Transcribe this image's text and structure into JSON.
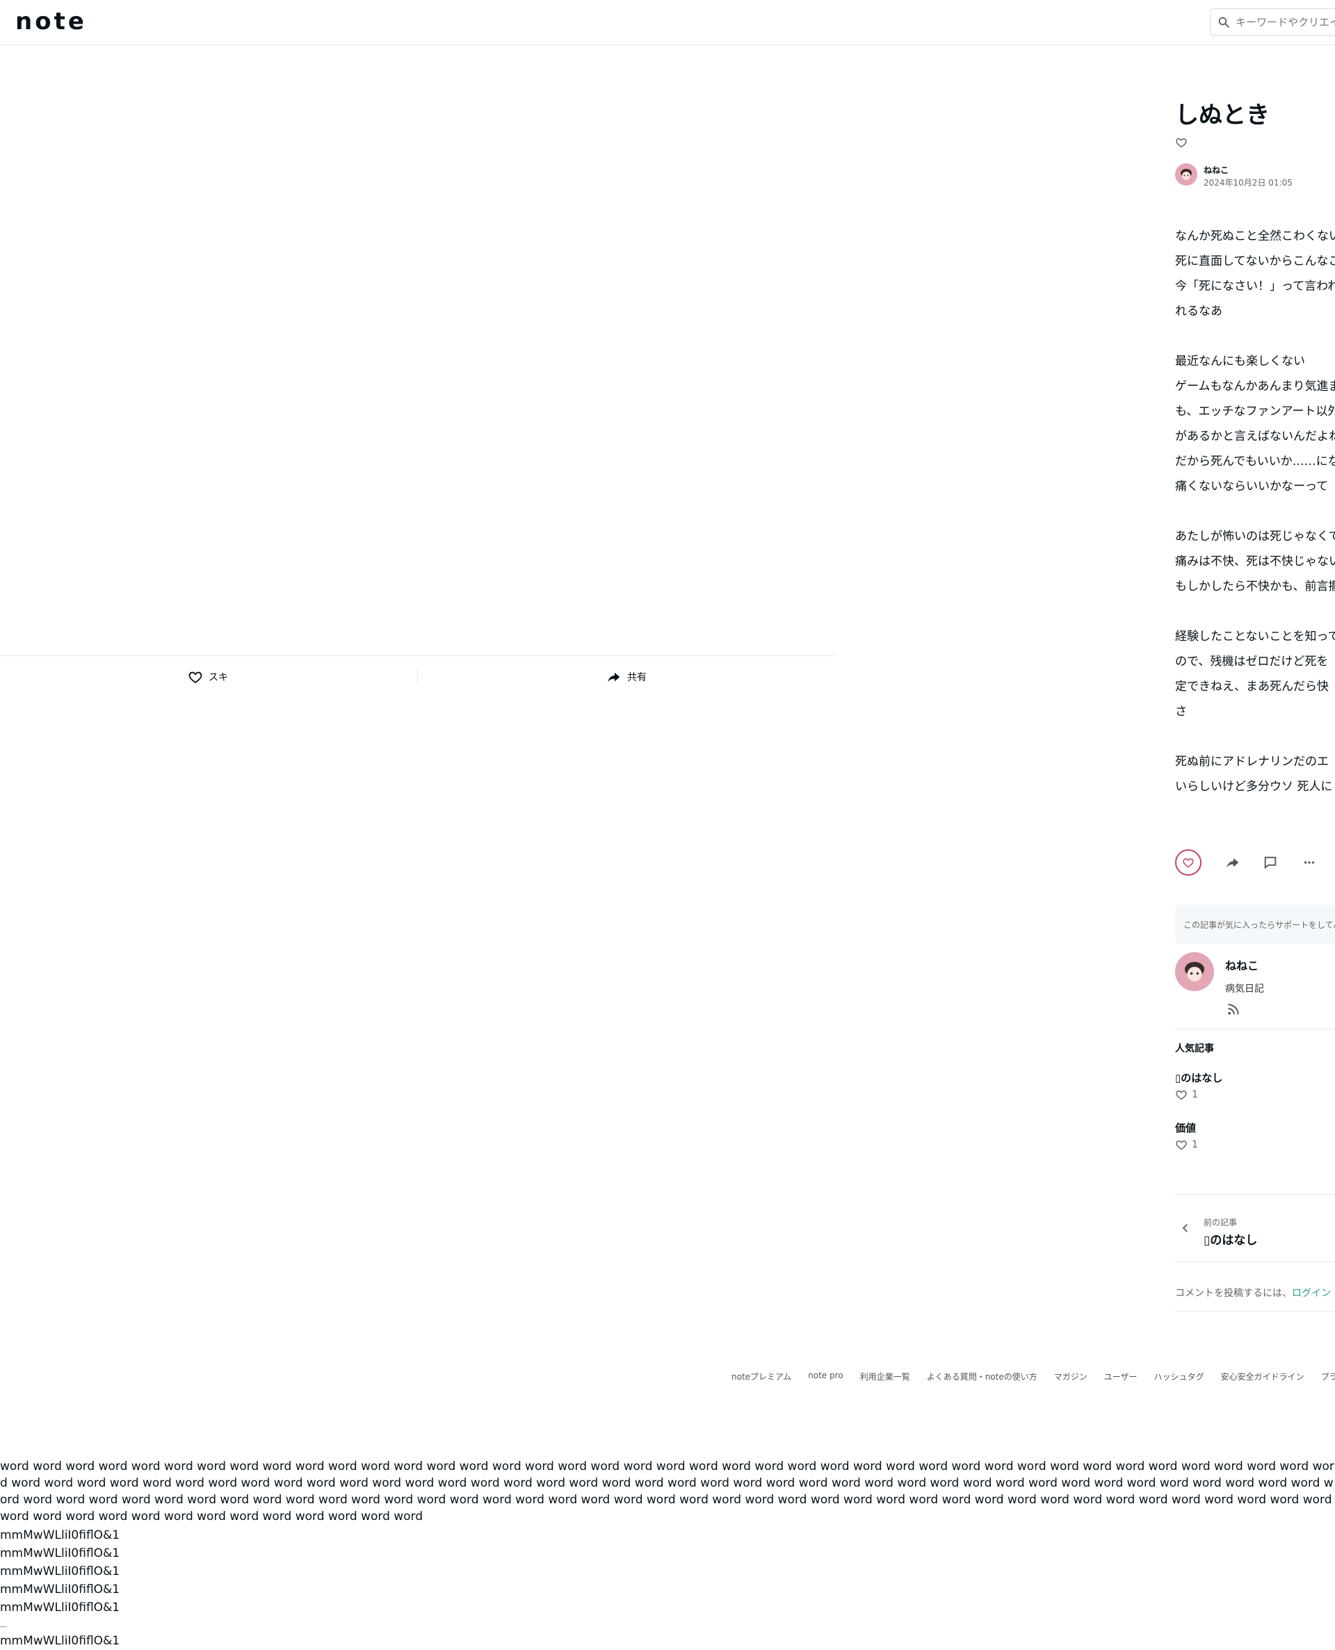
{
  "header": {
    "logo": "note",
    "search_placeholder": "キーワードやクリエイター"
  },
  "left_bar": {
    "like_label": "スキ",
    "share_label": "共有"
  },
  "article": {
    "title": "しぬとき",
    "author": "ねねこ",
    "date": "2024年10月2日 01:05",
    "paragraphs": [
      [
        "なんか死ぬこと全然こわくないん",
        "死に直面してないからこんなこと",
        "今「死になさい！」って言われたら",
        "れるなあ"
      ],
      [
        "最近なんにも楽しくない",
        "ゲームもなんかあんまり気進まない",
        "も、エッチなファンアート以外に",
        "があるかと言えばないんだよね",
        "だから死んでもいいか……にな",
        "痛くないならいいかなーって"
      ],
      [
        "あたしが怖いのは死じゃなくて",
        "痛みは不快、死は不快じゃない",
        "もしかしたら不快かも、前言撤回"
      ],
      [
        "経験したことないことを知って",
        "ので、残機はゼロだけど死を",
        "定できねえ、まあ死んだら快",
        "さ"
      ],
      [
        "死ぬ前にアドレナリンだのエ",
        "いらしいけど多分ウソ 死人に"
      ]
    ]
  },
  "support": {
    "text": "この記事が気に入ったらサポートをしてみませんか？"
  },
  "creator": {
    "name": "ねねこ",
    "description": "病気日記"
  },
  "popular": {
    "heading": "人気記事",
    "items": [
      {
        "title": "のはなし",
        "likes": "1"
      },
      {
        "title": "価値",
        "likes": "1"
      }
    ]
  },
  "prev": {
    "label": "前の記事",
    "title": "のはなし"
  },
  "comment": {
    "prefix": "コメントを投稿するには、",
    "link": "ログイン"
  },
  "footer": {
    "links": [
      "noteプレミアム",
      "note pro",
      "利用企業一覧",
      "よくある質問・noteの使い方",
      "マガジン",
      "ユーザー",
      "ハッシュタグ",
      "安心安全ガイドライン",
      "プライバシー"
    ]
  },
  "test_text": {
    "words": "word word word word word word word word word word word word word word word word word word word word word word word word word word word word word word word word word word word word word word word word word word word word word word word word word word word word word word word word word word word word word word word word word word word word word word word word word word word word word word word word word word word word word word word word word word word word word word word word word word word word word word word word word word word word word word word word word word word word word word word word word word word word word word word word word word word word word word word",
    "glyphs": [
      "mmMwWLliI0fiflO&1",
      "mmMwWLliI0fiflO&1",
      "mmMwWLliI0fiflO&1",
      "mmMwWLliI0fiflO&1",
      "mmMwWLliI0fiflO&1"
    ],
    "glyph_last": "mmMwWLliI0fiflO&1"
  }
}
